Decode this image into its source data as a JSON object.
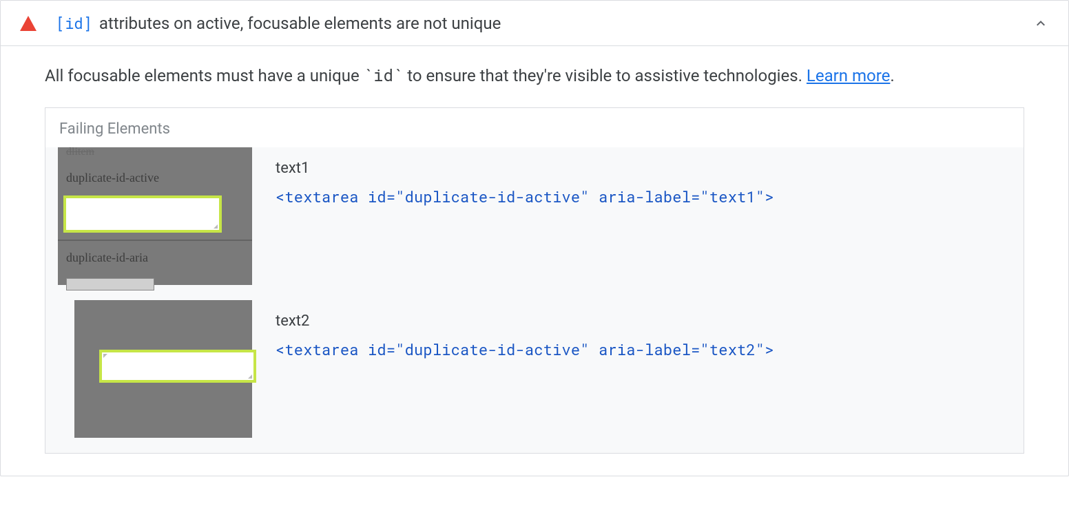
{
  "audit": {
    "id_badge": "[id]",
    "title_suffix": " attributes on active, focusable elements are not unique",
    "description_prefix": "All focusable elements must have a unique ",
    "description_code": "`id`",
    "description_suffix": " to ensure that they're visible to assistive technologies. ",
    "learn_more": "Learn more",
    "period": "."
  },
  "failing": {
    "heading": "Failing Elements",
    "items": [
      {
        "label": "text1",
        "code": "<textarea id=\"duplicate-id-active\" aria-label=\"text1\">",
        "thumb": {
          "faded_top": "dlitem",
          "text_a": "duplicate-id-active",
          "text_b": "duplicate-id-aria"
        }
      },
      {
        "label": "text2",
        "code": "<textarea id=\"duplicate-id-active\" aria-label=\"text2\">"
      }
    ]
  }
}
